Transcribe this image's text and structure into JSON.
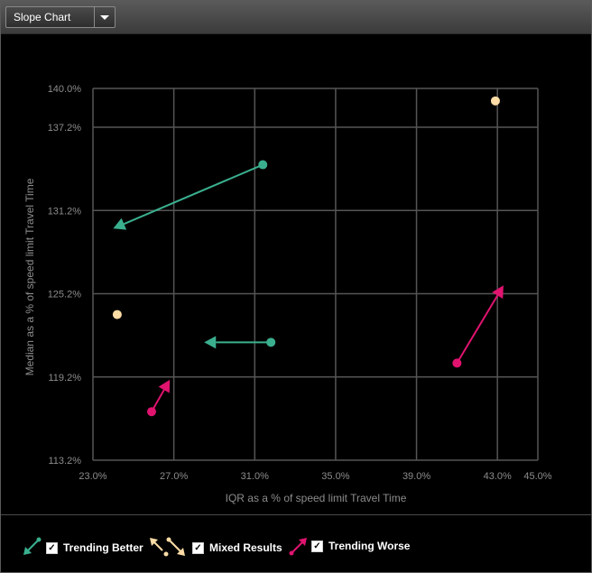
{
  "toolbar": {
    "selector_value": "Slope Chart"
  },
  "colors": {
    "better": "#3aaf8e",
    "mixed": "#fddca6",
    "worse": "#e0136f",
    "grid": "#555555",
    "axis_text": "#8c8c8c"
  },
  "legend": {
    "items": [
      {
        "label": "Trending Better",
        "icon": "arrow-down-left-icon",
        "checked": "✓"
      },
      {
        "label": "Mixed Results",
        "icon": "mixed-arrows-icon",
        "checked": "✓"
      },
      {
        "label": "Trending Worse",
        "icon": "arrow-up-right-icon",
        "checked": "✓"
      }
    ]
  },
  "chart_data": {
    "type": "scatter",
    "xlabel": "IQR as a % of speed limit Travel Time",
    "ylabel": "Median as a % of speed limit Travel Time",
    "xlim": [
      23,
      45
    ],
    "ylim": [
      113.2,
      140
    ],
    "x_ticks": [
      23,
      27,
      31,
      35,
      39,
      43,
      45
    ],
    "x_tick_labels": [
      "23.0%",
      "27.0%",
      "31.0%",
      "35.0%",
      "39.0%",
      "43.0%",
      "45.0%"
    ],
    "y_ticks": [
      113.2,
      119.2,
      125.2,
      131.2,
      137.2,
      140
    ],
    "y_tick_labels": [
      "113.2%",
      "119.2%",
      "125.2%",
      "131.2%",
      "137.2%",
      "140.0%"
    ],
    "grid": true,
    "legend_position": "bottom",
    "segments": [
      {
        "category": "better",
        "from": [
          31.4,
          134.5
        ],
        "to": [
          24.0,
          129.9
        ]
      },
      {
        "category": "better",
        "from": [
          31.8,
          121.7
        ],
        "to": [
          28.5,
          121.7
        ]
      },
      {
        "category": "worse",
        "from": [
          41.0,
          120.2
        ],
        "to": [
          43.3,
          125.8
        ]
      },
      {
        "category": "worse",
        "from": [
          25.9,
          116.7
        ],
        "to": [
          26.8,
          119.0
        ]
      }
    ],
    "points": [
      {
        "category": "mixed",
        "x": 42.9,
        "y": 139.1
      },
      {
        "category": "mixed",
        "x": 24.2,
        "y": 123.7
      }
    ]
  }
}
